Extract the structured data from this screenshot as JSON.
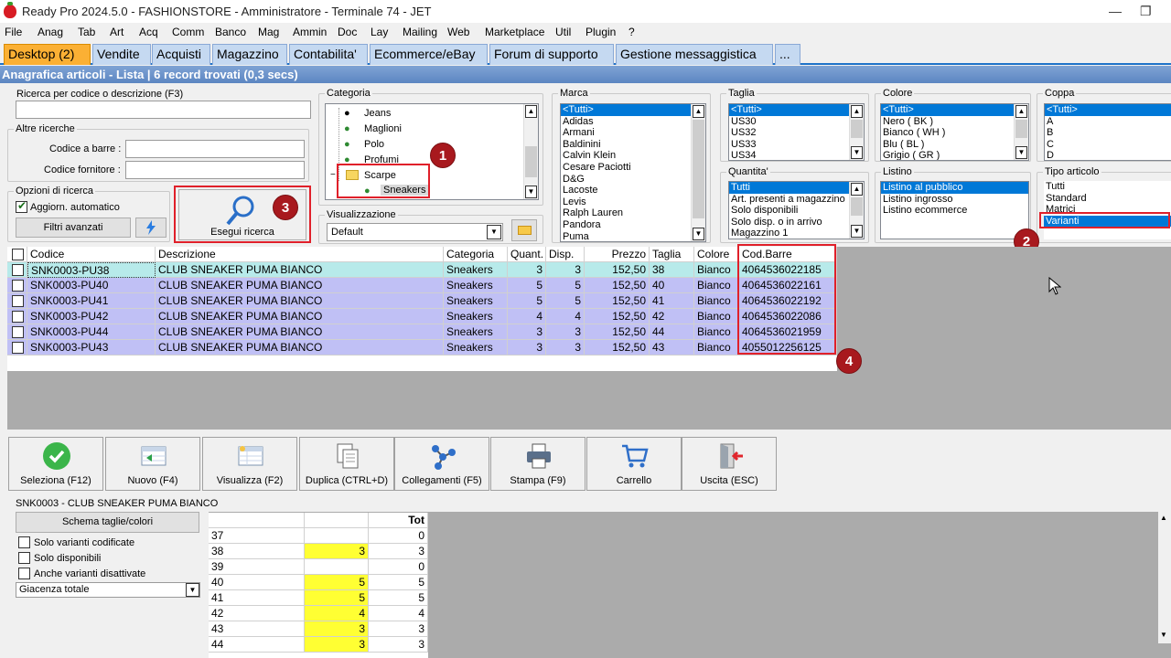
{
  "window": {
    "title": "Ready Pro 2024.5.0 - FASHIONSTORE - Amministratore - Terminale 74 - JET"
  },
  "menu": [
    "File",
    "Anag",
    "Tab",
    "Art",
    "Acq",
    "Comm",
    "Banco",
    "Mag",
    "Ammin",
    "Doc",
    "Lay",
    "Mailing",
    "Web",
    "Marketplace",
    "Util",
    "Plugin",
    "?"
  ],
  "tabs": [
    "Desktop (2)",
    "Vendite",
    "Acquisti",
    "Magazzino",
    "Contabilita'",
    "Ecommerce/eBay",
    "Forum di supporto",
    "Gestione messaggistica",
    "..."
  ],
  "header": {
    "title": "Anagrafica articoli  - Lista | 6 record trovati (0,3 secs)"
  },
  "search": {
    "label": "Ricerca per codice o descrizione (F3)",
    "value": ""
  },
  "altre": {
    "label": "Altre ricerche",
    "barcode_label": "Codice a barre :",
    "supplier_label": "Codice fornitore :"
  },
  "options": {
    "label": "Opzioni di ricerca",
    "auto_label": "Aggiorn. automatico",
    "filters_label": "Filtri avanzati",
    "run_label": "Esegui ricerca"
  },
  "categoria": {
    "label": "Categoria",
    "items": [
      "Jeans",
      "Maglioni",
      "Polo",
      "Profumi",
      "Scarpe",
      "Sneakers"
    ]
  },
  "visualizzazione": {
    "label": "Visualizzazione",
    "value": "Default"
  },
  "marca": {
    "label": "Marca",
    "items": [
      "<Tutti>",
      "Adidas",
      "Armani",
      "Baldinini",
      "Calvin Klein",
      "Cesare Paciotti",
      "D&G",
      "Lacoste",
      "Levis",
      "Ralph Lauren",
      "Pandora",
      "Puma"
    ]
  },
  "taglia": {
    "label": "Taglia",
    "items": [
      "<Tutti>",
      "US30",
      "US32",
      "US33",
      "US34"
    ]
  },
  "colore": {
    "label": "Colore",
    "items": [
      "<Tutti>",
      "Nero ( BK )",
      "Bianco ( WH )",
      "Blu ( BL )",
      "Grigio ( GR )"
    ]
  },
  "coppa": {
    "label": "Coppa",
    "items": [
      "<Tutti>",
      "A",
      "B",
      "C",
      "D"
    ]
  },
  "quantita": {
    "label": "Quantita'",
    "items": [
      "Tutti",
      "Art. presenti a magazzino",
      "Solo disponibili",
      "Solo disp. o in arrivo",
      "Magazzino 1"
    ]
  },
  "listino": {
    "label": "Listino",
    "items": [
      "Listino al pubblico",
      "Listino ingrosso",
      "Listino ecommerce"
    ]
  },
  "tipo": {
    "label": "Tipo articolo",
    "items": [
      "Tutti",
      "Standard",
      "Matrici",
      "Varianti"
    ]
  },
  "markers": [
    "1",
    "2",
    "3",
    "4"
  ],
  "grid": {
    "headers": [
      "Codice",
      "Descrizione",
      "Categoria",
      "Quant.",
      "Disp.",
      "Prezzo",
      "Taglia",
      "Colore",
      "Cod.Barre"
    ],
    "rows": [
      [
        "SNK0003-PU38",
        "CLUB SNEAKER PUMA BIANCO",
        "Sneakers",
        "3",
        "3",
        "152,50",
        "38",
        "Bianco",
        "4064536022185"
      ],
      [
        "SNK0003-PU40",
        "CLUB SNEAKER PUMA BIANCO",
        "Sneakers",
        "5",
        "5",
        "152,50",
        "40",
        "Bianco",
        "4064536022161"
      ],
      [
        "SNK0003-PU41",
        "CLUB SNEAKER PUMA BIANCO",
        "Sneakers",
        "5",
        "5",
        "152,50",
        "41",
        "Bianco",
        "4064536022192"
      ],
      [
        "SNK0003-PU42",
        "CLUB SNEAKER PUMA BIANCO",
        "Sneakers",
        "4",
        "4",
        "152,50",
        "42",
        "Bianco",
        "4064536022086"
      ],
      [
        "SNK0003-PU44",
        "CLUB SNEAKER PUMA BIANCO",
        "Sneakers",
        "3",
        "3",
        "152,50",
        "44",
        "Bianco",
        "4064536021959"
      ],
      [
        "SNK0003-PU43",
        "CLUB SNEAKER PUMA BIANCO",
        "Sneakers",
        "3",
        "3",
        "152,50",
        "43",
        "Bianco",
        "4055012256125"
      ]
    ]
  },
  "toolbar": [
    "Seleziona (F12)",
    "Nuovo (F4)",
    "Visualizza (F2)",
    "Duplica (CTRL+D)",
    "Collegamenti (F5)",
    "Stampa (F9)",
    "Carrello",
    "Uscita (ESC)"
  ],
  "detail": {
    "title": "SNK0003 - CLUB SNEAKER PUMA BIANCO",
    "schema_label": "Schema taglie/colori",
    "chk1": "Solo varianti codificate",
    "chk2": "Solo disponibili",
    "chk3": "Anche varianti disattivate",
    "giacenza": "Giacenza totale",
    "tot_header": "Tot",
    "rows": [
      [
        "37",
        "",
        "0"
      ],
      [
        "38",
        "3",
        "3"
      ],
      [
        "39",
        "",
        "0"
      ],
      [
        "40",
        "5",
        "5"
      ],
      [
        "41",
        "5",
        "5"
      ],
      [
        "42",
        "4",
        "4"
      ],
      [
        "43",
        "3",
        "3"
      ],
      [
        "44",
        "3",
        "3"
      ]
    ]
  }
}
